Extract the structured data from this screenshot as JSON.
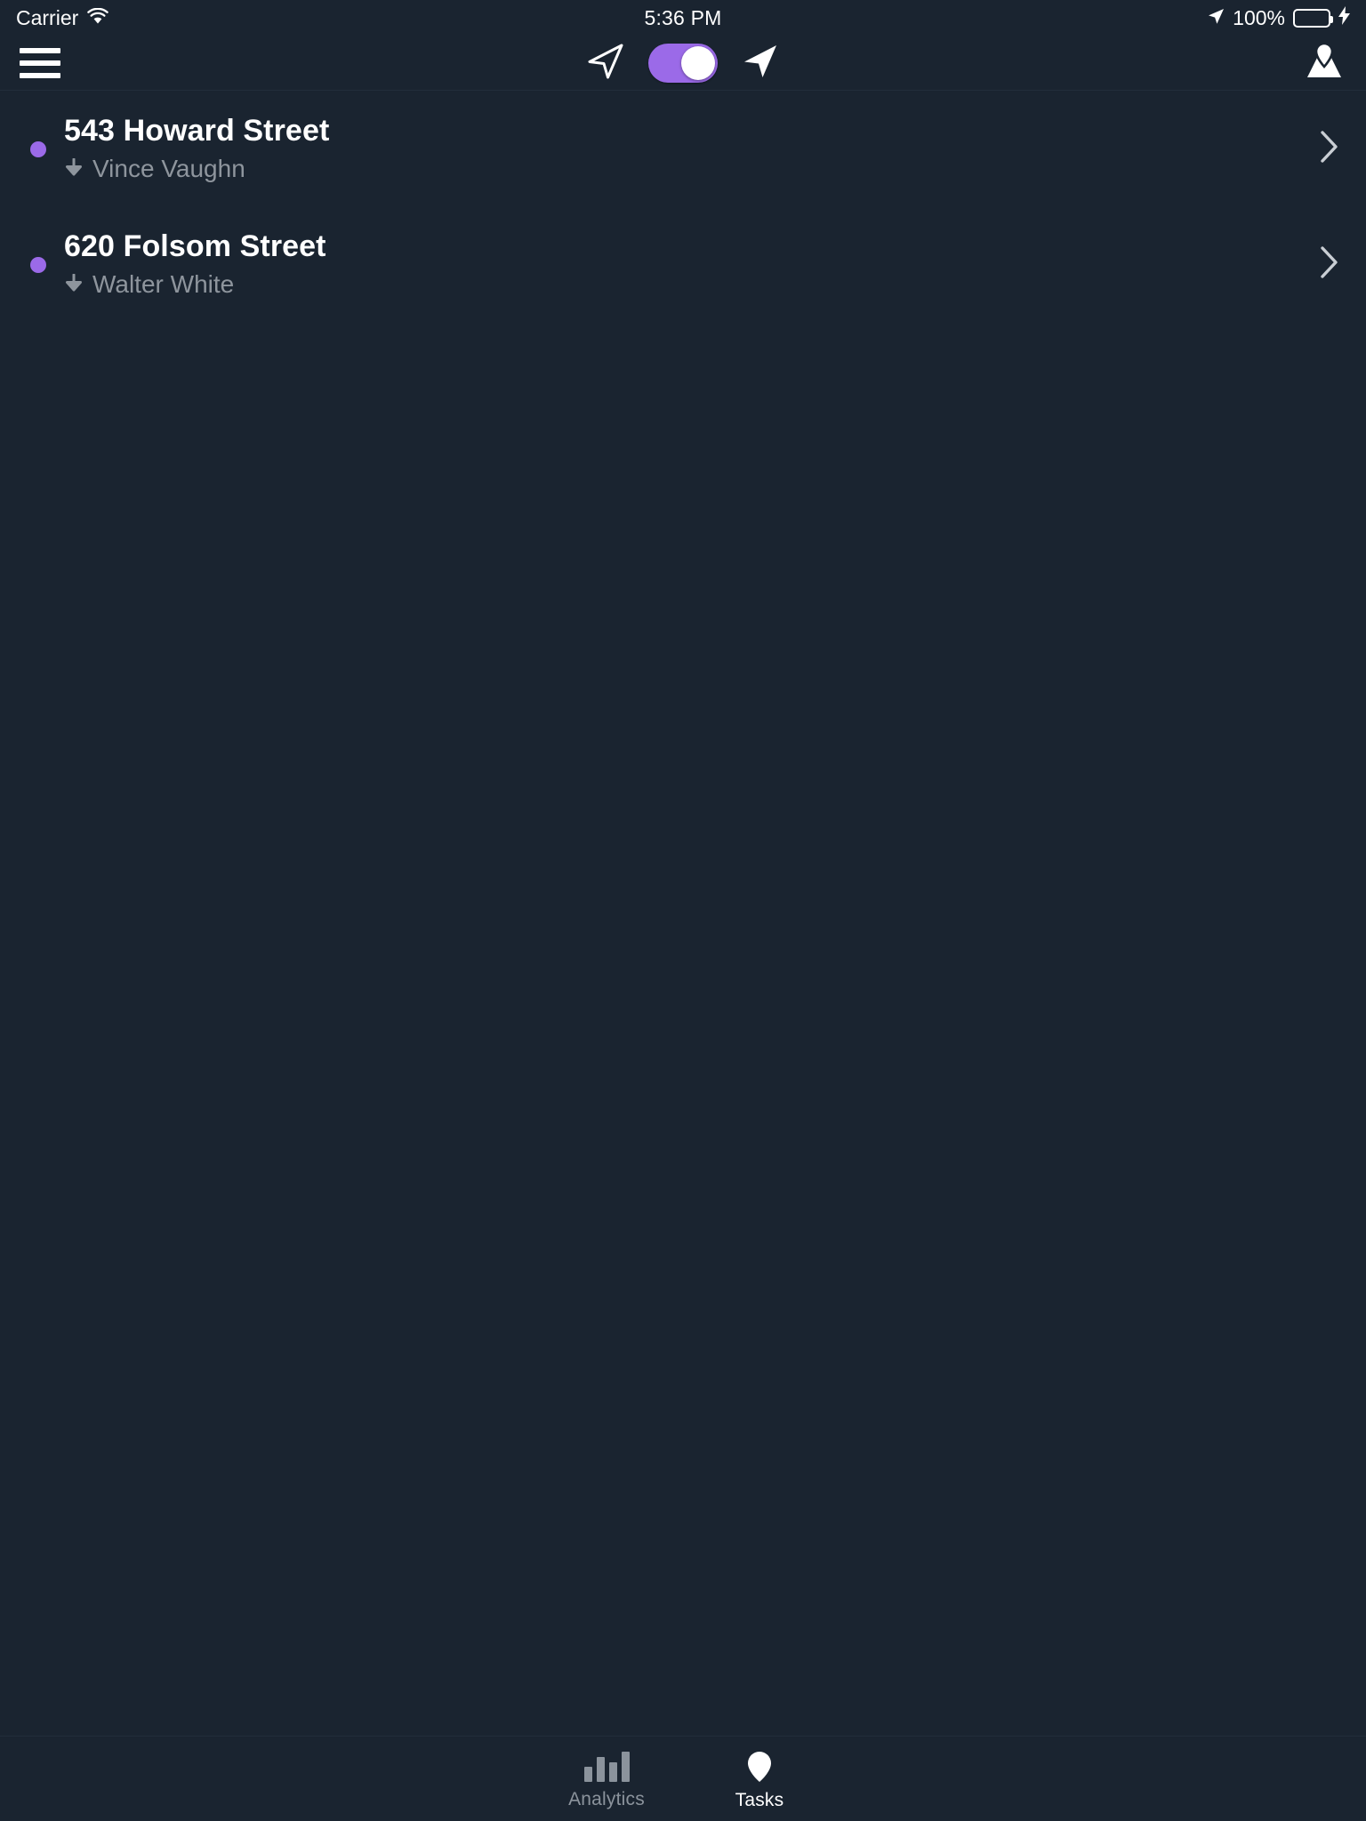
{
  "status_bar": {
    "carrier": "Carrier",
    "wifi_icon": "wifi-icon",
    "time": "5:36 PM",
    "location_icon": "location-arrow-icon",
    "battery_percent": "100%",
    "battery_icon": "battery-full-icon",
    "charging_icon": "lightning-bolt-icon",
    "battery_level": 100,
    "battery_color": "#4cd964"
  },
  "nav_bar": {
    "menu_icon": "hamburger-menu-icon",
    "arrow_outline_icon": "navigation-arrow-outline-icon",
    "arrow_filled_icon": "navigation-arrow-filled-icon",
    "toggle_on": true,
    "toggle_color": "#9b6ae8",
    "map_icon": "map-pin-icon"
  },
  "tasks": {
    "dot_color": "#9b6ae8",
    "items": [
      {
        "title": "543 Howard Street",
        "person": "Vince Vaughn",
        "type_icon": "dropoff-arrow-down-icon",
        "chevron_icon": "chevron-right-icon",
        "status_dot": "status-dot"
      },
      {
        "title": "620 Folsom Street",
        "person": "Walter White",
        "type_icon": "dropoff-arrow-down-icon",
        "chevron_icon": "chevron-right-icon",
        "status_dot": "status-dot"
      }
    ]
  },
  "tab_bar": {
    "tabs": [
      {
        "label": "Analytics",
        "icon": "bar-chart-icon",
        "active": false
      },
      {
        "label": "Tasks",
        "icon": "map-pin-icon",
        "active": true
      }
    ]
  }
}
